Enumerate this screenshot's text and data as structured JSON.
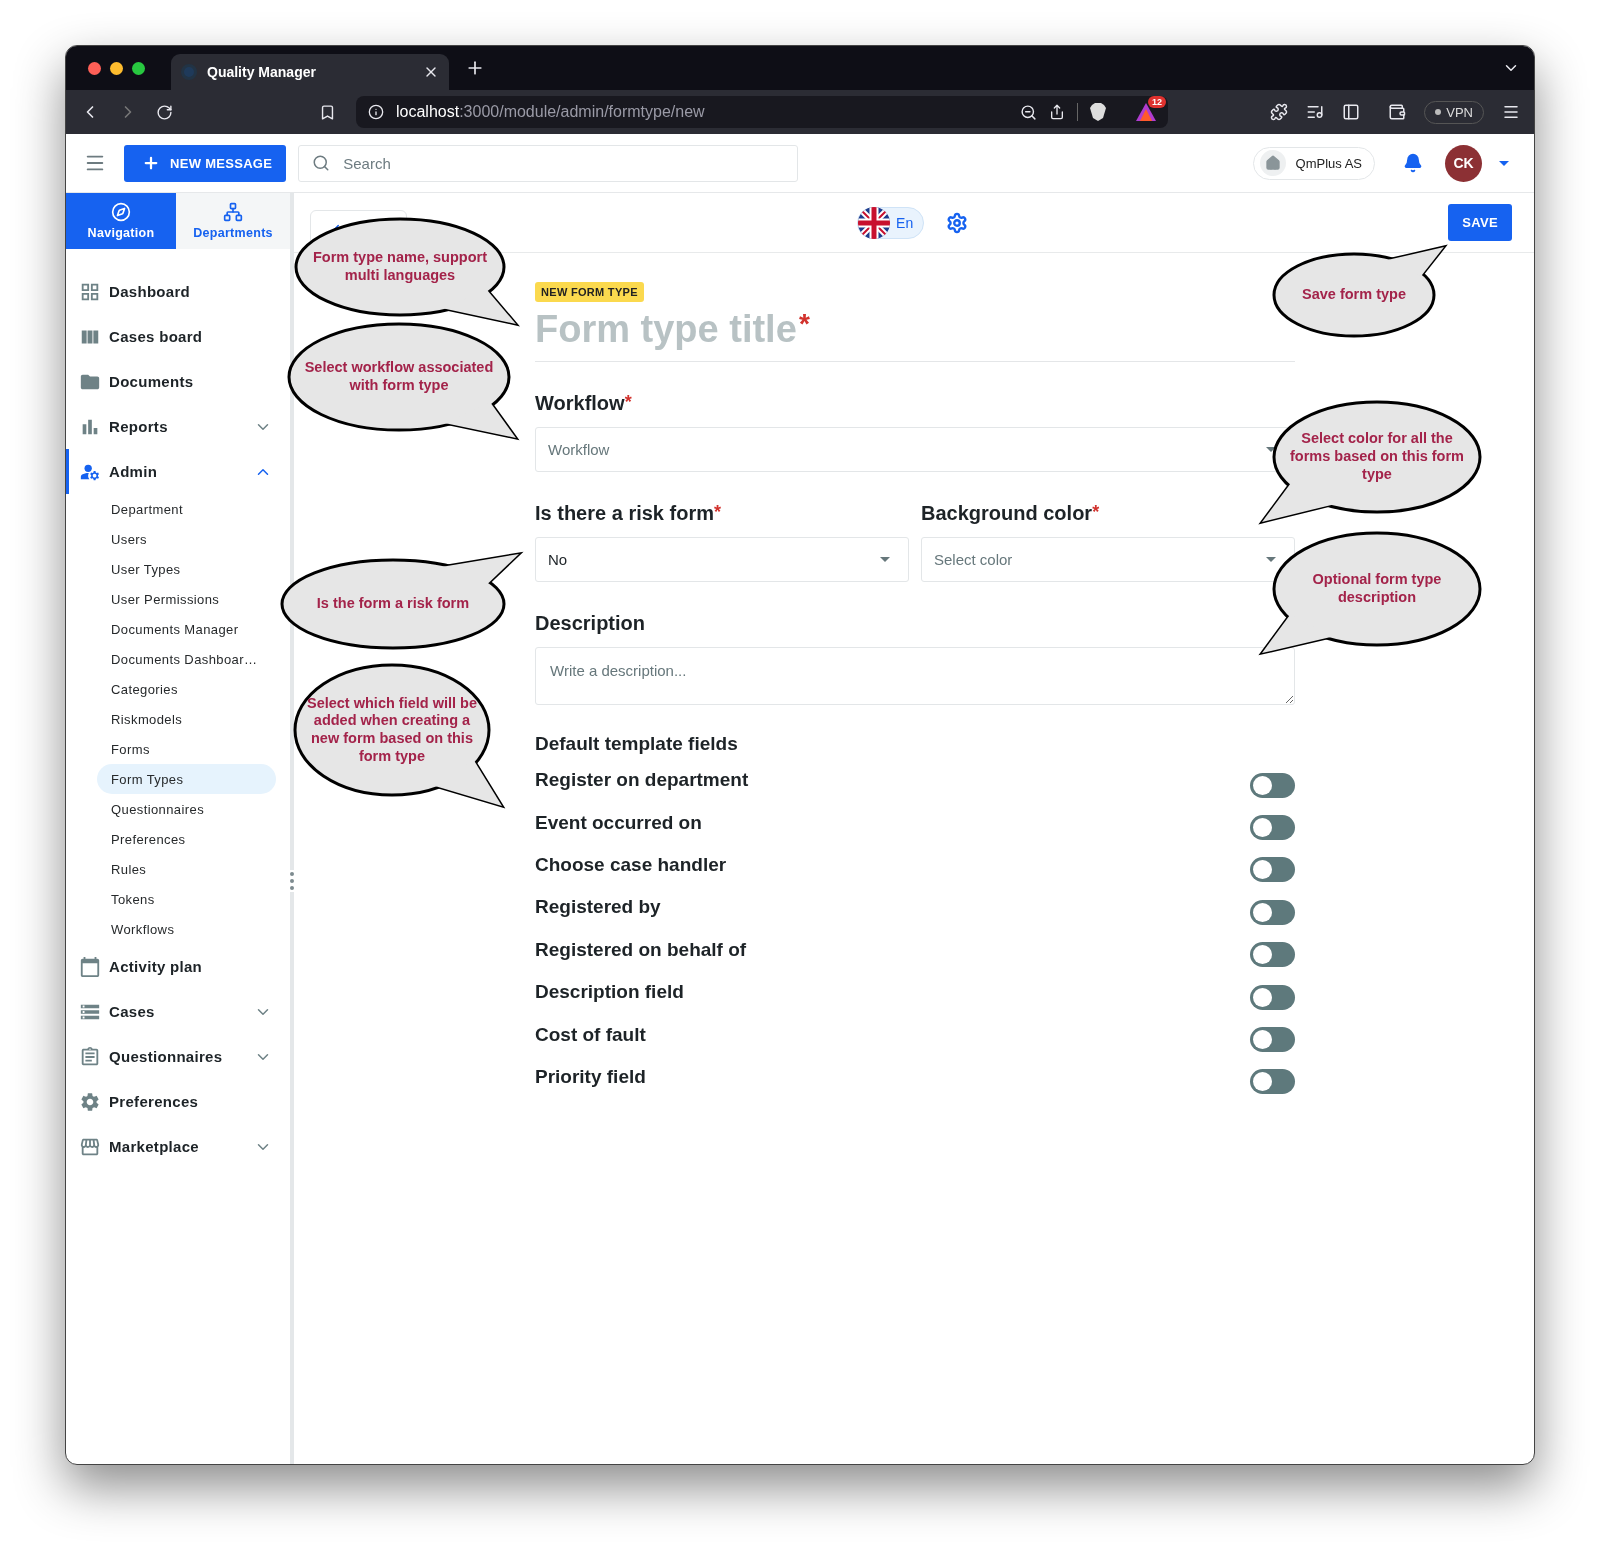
{
  "browser": {
    "tab_title": "Quality Manager",
    "url": "**localhost**:3000/module/admin/formtype/new",
    "notification_badge": "12",
    "vpn_label": "VPN"
  },
  "header": {
    "new_message_button": "NEW MESSAGE",
    "search": {
      "placeholder": "Search"
    },
    "company": "QmPlus AS",
    "avatar_initials": "CK"
  },
  "sidebar": {
    "tabs": [
      {
        "label": "Navigation",
        "selected": true
      },
      {
        "label": "Departments",
        "selected": false
      }
    ],
    "items": [
      {
        "label": "Dashboard",
        "selected": false
      },
      {
        "label": "Cases board",
        "selected": false
      },
      {
        "label": "Documents",
        "selected": false
      },
      {
        "label": "Reports",
        "selected": false,
        "expanded": false
      },
      {
        "label": "Admin",
        "selected": true,
        "expanded": true,
        "children": [
          {
            "label": "Department",
            "selected": false
          },
          {
            "label": "Users",
            "selected": false
          },
          {
            "label": "User Types",
            "selected": false
          },
          {
            "label": "User Permissions",
            "selected": false
          },
          {
            "label": "Documents Manager",
            "selected": false
          },
          {
            "label": "Documents Dashboar…",
            "selected": false
          },
          {
            "label": "Categories",
            "selected": false
          },
          {
            "label": "Riskmodels",
            "selected": false
          },
          {
            "label": "Forms",
            "selected": false
          },
          {
            "label": "Form Types",
            "selected": true
          },
          {
            "label": "Questionnaires",
            "selected": false
          },
          {
            "label": "Preferences",
            "selected": false
          },
          {
            "label": "Rules",
            "selected": false
          },
          {
            "label": "Tokens",
            "selected": false
          },
          {
            "label": "Workflows",
            "selected": false
          }
        ]
      },
      {
        "label": "Activity plan",
        "selected": false
      },
      {
        "label": "Cases",
        "selected": false,
        "expanded": false
      },
      {
        "label": "Questionnaires",
        "selected": false,
        "expanded": false
      },
      {
        "label": "Preferences",
        "selected": false
      },
      {
        "label": "Marketplace",
        "selected": false,
        "expanded": false
      }
    ]
  },
  "toolbar": {
    "language": "En",
    "save_button": "SAVE"
  },
  "form": {
    "badge": "NEW FORM TYPE",
    "title": {
      "placeholder": "Form type title",
      "required_mark": "*"
    },
    "workflow": {
      "label": "Workflow",
      "required_mark": "*",
      "placeholder": "Workflow"
    },
    "risk_form": {
      "label": "Is there a risk form",
      "required_mark": "*",
      "value": "No"
    },
    "background_color": {
      "label": "Background color",
      "required_mark": "*",
      "placeholder": "Select color"
    },
    "description": {
      "label": "Description",
      "placeholder": "Write a description..."
    },
    "template_fields": {
      "heading": "Default template fields",
      "fields": [
        {
          "label": "Register on department",
          "on": false
        },
        {
          "label": "Event occurred on",
          "on": false
        },
        {
          "label": "Choose case handler",
          "on": false
        },
        {
          "label": "Registered by",
          "on": false
        },
        {
          "label": "Registered on behalf of",
          "on": false
        },
        {
          "label": "Description field",
          "on": false
        },
        {
          "label": "Cost of fault",
          "on": false
        },
        {
          "label": "Priority field",
          "on": false
        }
      ]
    }
  },
  "callouts": [
    {
      "text": "Form type name, support multi languages"
    },
    {
      "text": "Select workflow associated with form type"
    },
    {
      "text": "Is the form a risk form"
    },
    {
      "text": "Select which field will be added when creating a new form based on this form type"
    },
    {
      "text": "Save form type"
    },
    {
      "text": "Select color for all the forms based on this form type"
    },
    {
      "text": "Optional form type description"
    }
  ]
}
